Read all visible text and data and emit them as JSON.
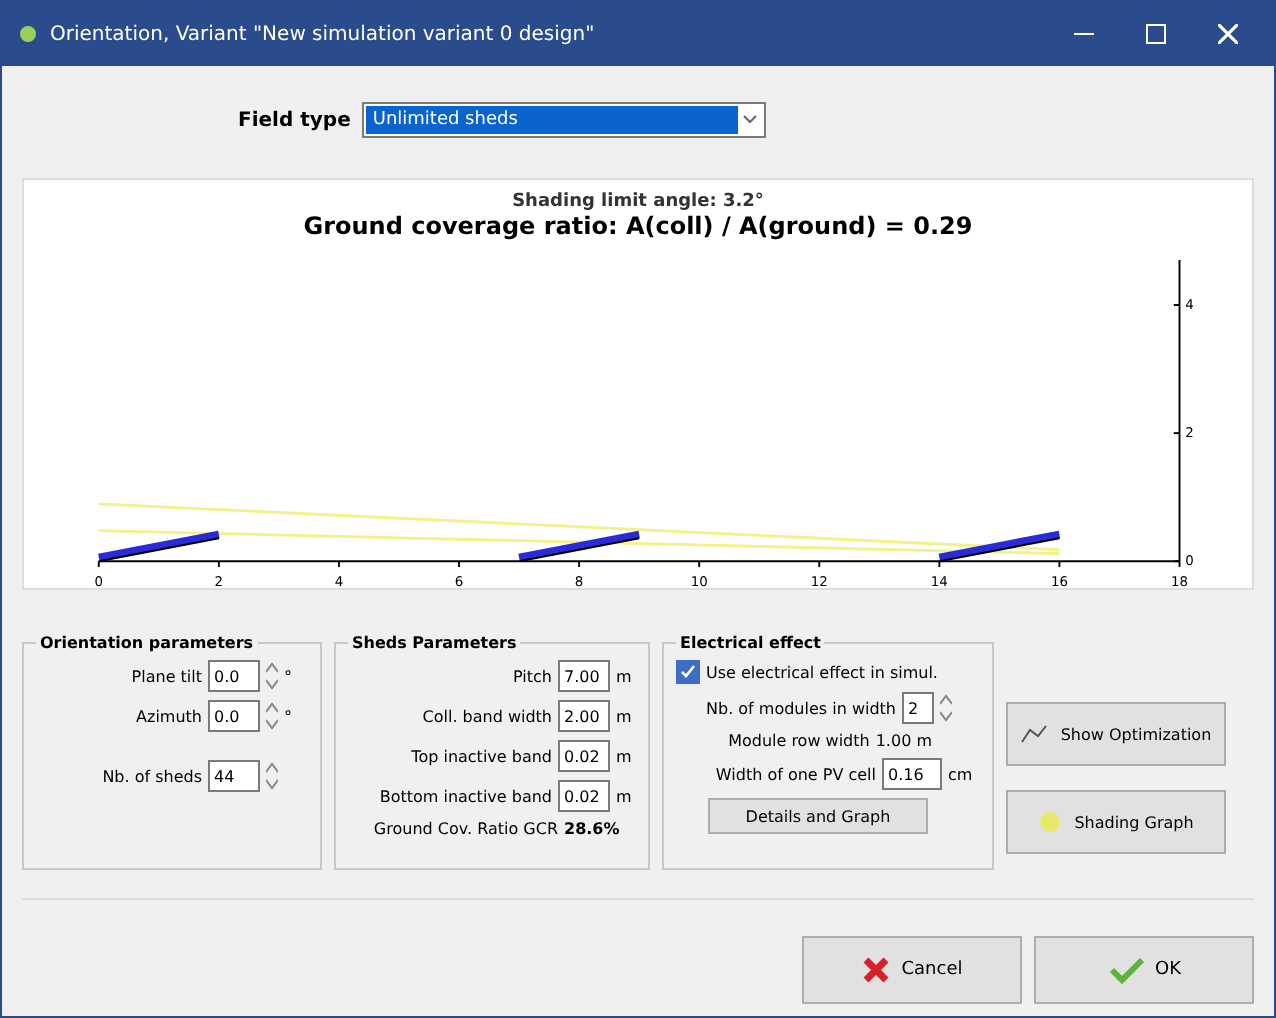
{
  "window": {
    "title": "Orientation, Variant \"New simulation variant 0 design\""
  },
  "field_type": {
    "label": "Field type",
    "value": "Unlimited sheds"
  },
  "chart": {
    "subtitle": "Shading limit angle:   3.2°",
    "title": "Ground coverage ratio: A(coll) / A(ground) = 0.29",
    "x_ticks": [
      "0",
      "2",
      "4",
      "6",
      "8",
      "10",
      "12",
      "14",
      "16",
      "18"
    ],
    "y_ticks": [
      "4",
      "2",
      "0"
    ]
  },
  "orientation": {
    "title": "Orientation parameters",
    "fields": [
      {
        "label": "Plane tilt",
        "value": "0.0",
        "unit": "°"
      },
      {
        "label": "Azimuth",
        "value": "0.0",
        "unit": "°"
      },
      {
        "label": "Nb. of sheds",
        "value": "44"
      }
    ]
  },
  "sheds": {
    "title": "Sheds Parameters",
    "fields": [
      {
        "label": "Pitch",
        "value": "7.00",
        "unit": "m"
      },
      {
        "label": "Coll. band width",
        "value": "2.00",
        "unit": "m"
      },
      {
        "label": "Top inactive band",
        "value": "0.02",
        "unit": "m"
      },
      {
        "label": "Bottom inactive band",
        "value": "0.02",
        "unit": "m"
      }
    ],
    "gcr_label": "Ground Cov. Ratio GCR",
    "gcr_value": "28.6%"
  },
  "electrical": {
    "title": "Electrical effect",
    "use": {
      "label": "Use electrical effect in simul.",
      "checked": true
    },
    "modules": {
      "label": "Nb. of modules in width",
      "value": "2"
    },
    "row_width": {
      "label": "Module row width",
      "value": "1.00 m"
    },
    "cell_width": {
      "label": "Width of one PV cell",
      "value": "0.16",
      "unit": "cm"
    },
    "details_button": "Details and Graph"
  },
  "side_buttons": [
    "Show Optimization",
    "Shading Graph"
  ],
  "buttons": {
    "cancel": "Cancel",
    "ok": "OK"
  }
}
